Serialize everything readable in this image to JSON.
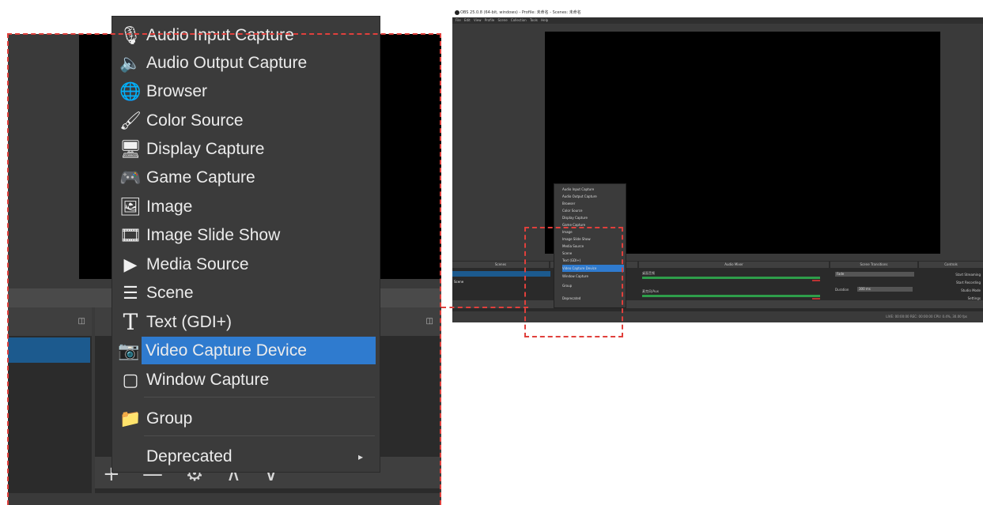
{
  "menu": {
    "items": [
      {
        "label": "Audio Input Capture",
        "icon": "microphone-icon",
        "glyph": "🎙"
      },
      {
        "label": "Audio Output Capture",
        "icon": "speaker-icon",
        "glyph": "🔈"
      },
      {
        "label": "Browser",
        "icon": "globe-icon",
        "glyph": "🌐"
      },
      {
        "label": "Color Source",
        "icon": "paint-brush-icon",
        "glyph": "🖌"
      },
      {
        "label": "Display Capture",
        "icon": "monitor-icon",
        "glyph": "🖥"
      },
      {
        "label": "Game Capture",
        "icon": "gamepad-icon",
        "glyph": "🎮"
      },
      {
        "label": "Image",
        "icon": "image-icon",
        "glyph": "🖼"
      },
      {
        "label": "Image Slide Show",
        "icon": "slideshow-icon",
        "glyph": "🎞"
      },
      {
        "label": "Media Source",
        "icon": "play-icon",
        "glyph": "▶"
      },
      {
        "label": "Scene",
        "icon": "list-icon",
        "glyph": "☰"
      },
      {
        "label": "Text (GDI+)",
        "icon": "text-icon",
        "glyph": "T"
      },
      {
        "label": "Video Capture Device",
        "icon": "camera-icon",
        "glyph": "📷"
      },
      {
        "label": "Window Capture",
        "icon": "window-icon",
        "glyph": "▢"
      },
      {
        "label": "Group",
        "icon": "folder-icon",
        "glyph": "📁"
      },
      {
        "label": "Deprecated",
        "icon": "",
        "glyph": ""
      }
    ],
    "selected": "Video Capture Device",
    "accent": "#2f7bcf"
  },
  "dock_tools": "+ — ⚙ ∧ ∨",
  "small_window": {
    "title": "OBS 25.0.8 (64-bit, windows) - Profile: 未命名 - Scenes: 未命名",
    "menubar": "File Edit View Profile Scene Collection Tools Help",
    "dock_headers": [
      "Scenes",
      "Sources",
      "Audio Mixer",
      "Scene Transitions",
      "Controls"
    ],
    "scene_item": "Scene",
    "transition_value": "Fade",
    "duration_label": "Duration",
    "duration_value": "300 ms",
    "mixer_labels": [
      "桌面音频",
      "麦克风/Aux"
    ],
    "status_text": "LIVE: 00:00:00   REC: 00:00:00   CPU: 0.4%, 30.00 fps",
    "control_labels": [
      "Start Streaming",
      "Start Recording",
      "Studio Mode",
      "Settings",
      "Exit"
    ]
  },
  "annotation_color": "#e0403c"
}
